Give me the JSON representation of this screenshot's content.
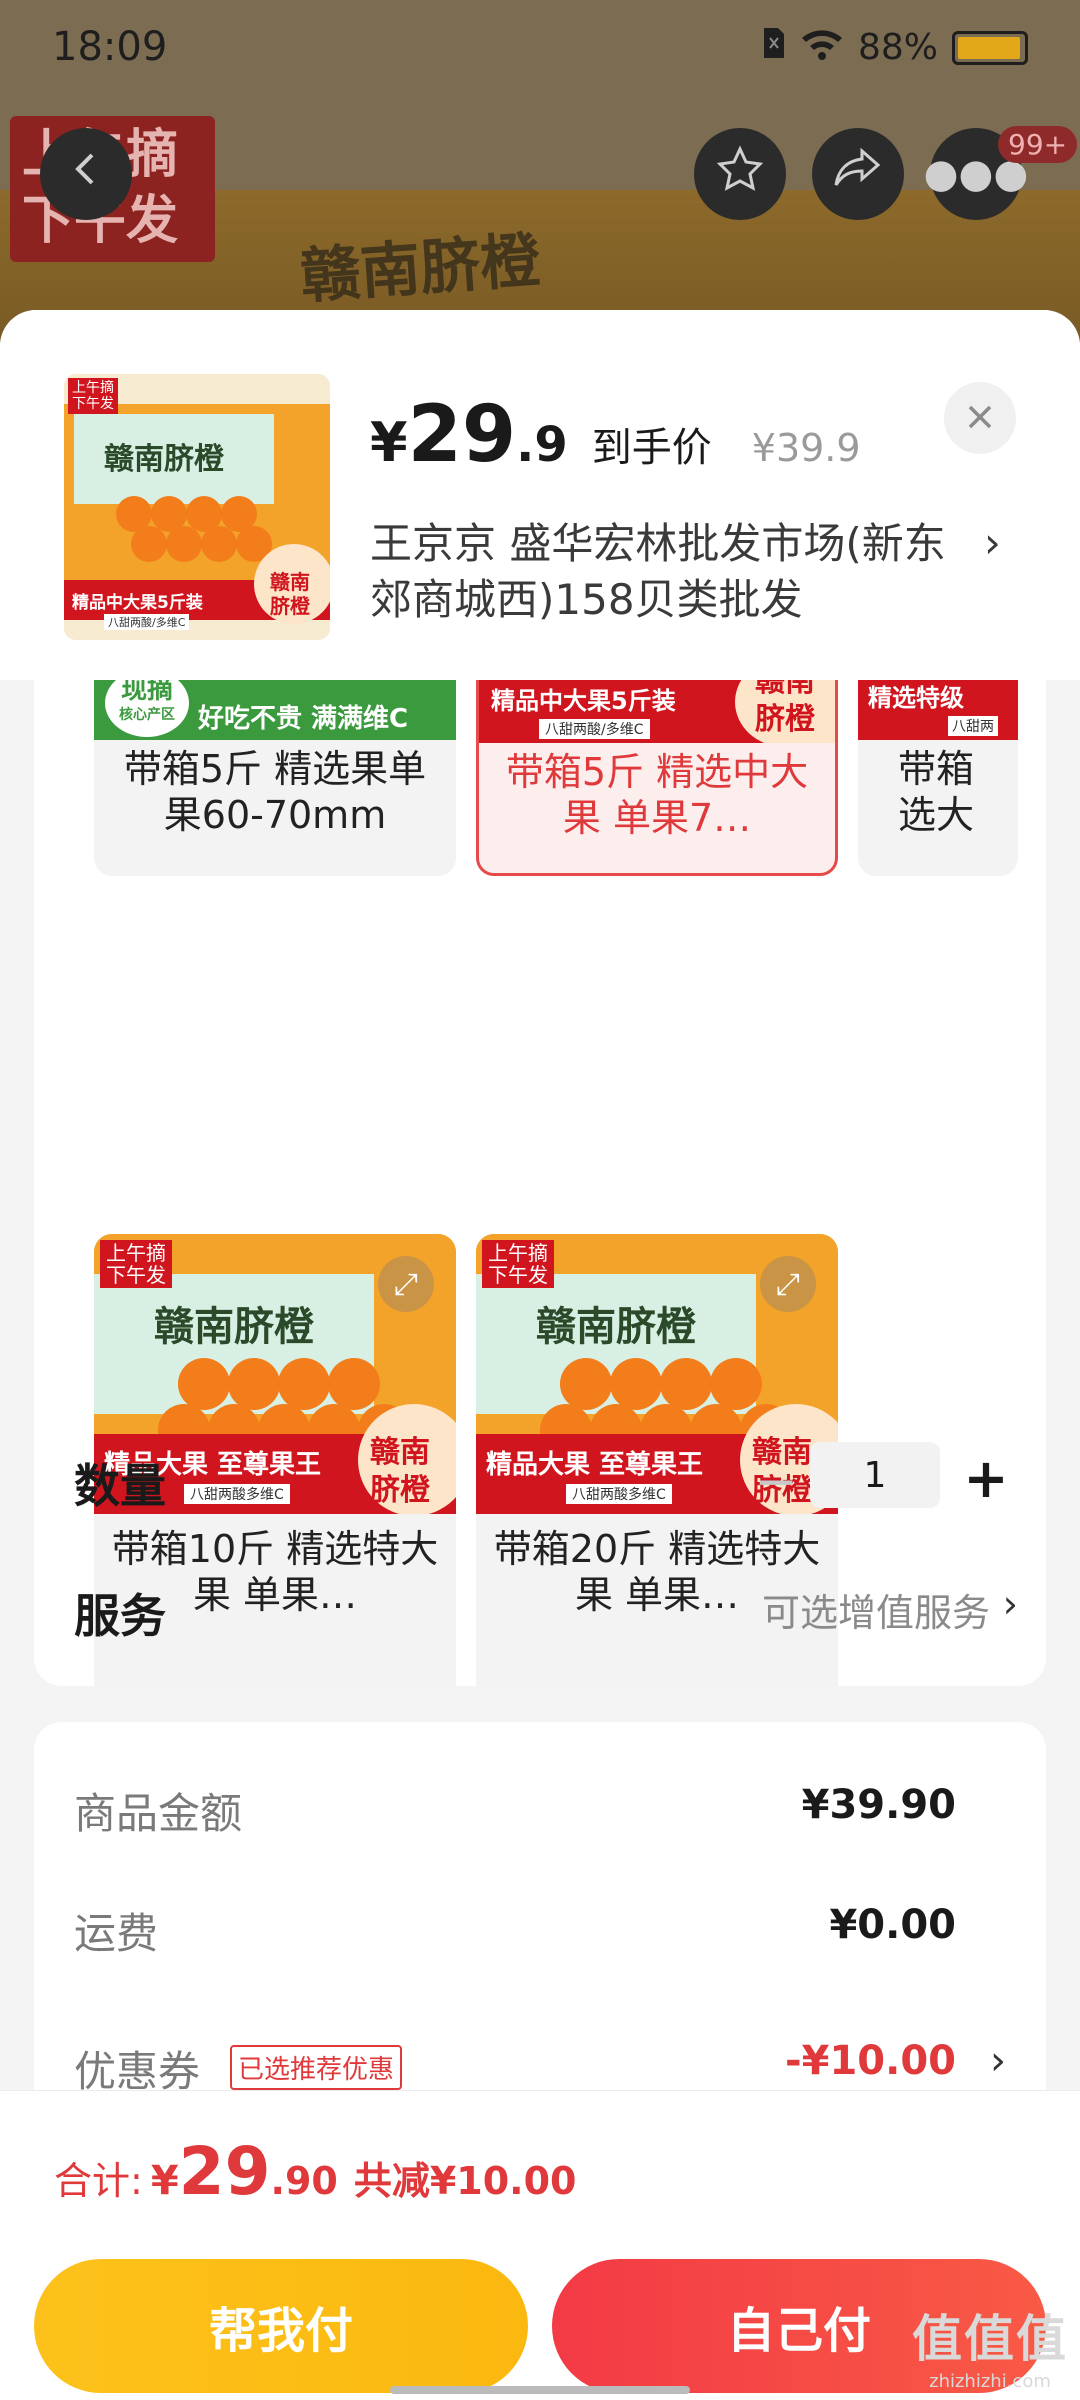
{
  "status_bar": {
    "time": "18:09",
    "battery": "88%",
    "battery_level": 0.88
  },
  "background": {
    "badge_line1": "上午摘",
    "badge_line2": "下午发",
    "box_text": "赣南脐橙",
    "more_count": "99+"
  },
  "header": {
    "currency": "¥",
    "price_int": "29",
    "price_dec": ".9",
    "price_label": "到手价",
    "original_price": "¥39.9",
    "address": "王京京  盛华宏林批发市场(新东郊商城西)158贝类批发",
    "thumb": {
      "badge_line1": "上午摘",
      "badge_line2": "下午发",
      "banner": "精品中大果5斤装",
      "sub": "八甜两酸/多维C",
      "brand_line1": "赣南",
      "brand_line2": "脐橙",
      "title": "赣南脐橙"
    }
  },
  "options": [
    {
      "label": "带箱5斤 精选果单果60-70mm",
      "banner": "好吃不贵 满满维C",
      "tag1": "现摘",
      "tag2": "核心产区",
      "selected": false
    },
    {
      "label": "带箱5斤 精选中大果 单果7…",
      "banner": "精品中大果5斤装",
      "sub": "八甜两酸/多维C",
      "brand_line1": "赣南",
      "brand_line2": "脐橙",
      "selected": true
    },
    {
      "label": "带箱 选大",
      "banner": "精选特级",
      "sub": "八甜两",
      "selected": false
    },
    {
      "label": "带箱10斤 精选特大果 单果…",
      "banner": "精品大果 至尊果王",
      "sub": "八甜两酸多维C",
      "badge_line1": "上午摘",
      "badge_line2": "下午发",
      "brand_line1": "赣南",
      "brand_line2": "脐橙",
      "title": "赣南脐橙",
      "selected": false
    },
    {
      "label": "带箱20斤 精选特大果 单果…",
      "banner": "精品大果 至尊果王",
      "sub": "八甜两酸多维C",
      "badge_line1": "上午摘",
      "badge_line2": "下午发",
      "brand_line1": "赣南",
      "brand_line2": "脐橙",
      "title": "赣南脐橙",
      "selected": false
    }
  ],
  "quantity": {
    "label": "数量",
    "value": "1",
    "minus": "−",
    "plus": "+"
  },
  "service": {
    "label": "服务",
    "hint": "可选增值服务",
    "arrow": "›"
  },
  "price_breakdown": {
    "goods_label": "商品金额",
    "goods_value": "¥39.90",
    "shipping_label": "运费",
    "shipping_value": "¥0.00",
    "coupon_label": "优惠券",
    "coupon_tag": "已选推荐优惠",
    "coupon_value": "-¥10.00"
  },
  "footer": {
    "total_label": "合计:",
    "currency": "¥",
    "total_int": "29",
    "total_dec": ".90",
    "discount": "共减¥10.00",
    "help_pay": "帮我付",
    "self_pay": "自己付"
  },
  "watermark": {
    "line1": "值值值",
    "line2": "zhizhizhi.com"
  },
  "colors": {
    "accent_red": "#e0393b",
    "help_yellow": "#fcc21b",
    "pay_red": "#f33a45"
  }
}
